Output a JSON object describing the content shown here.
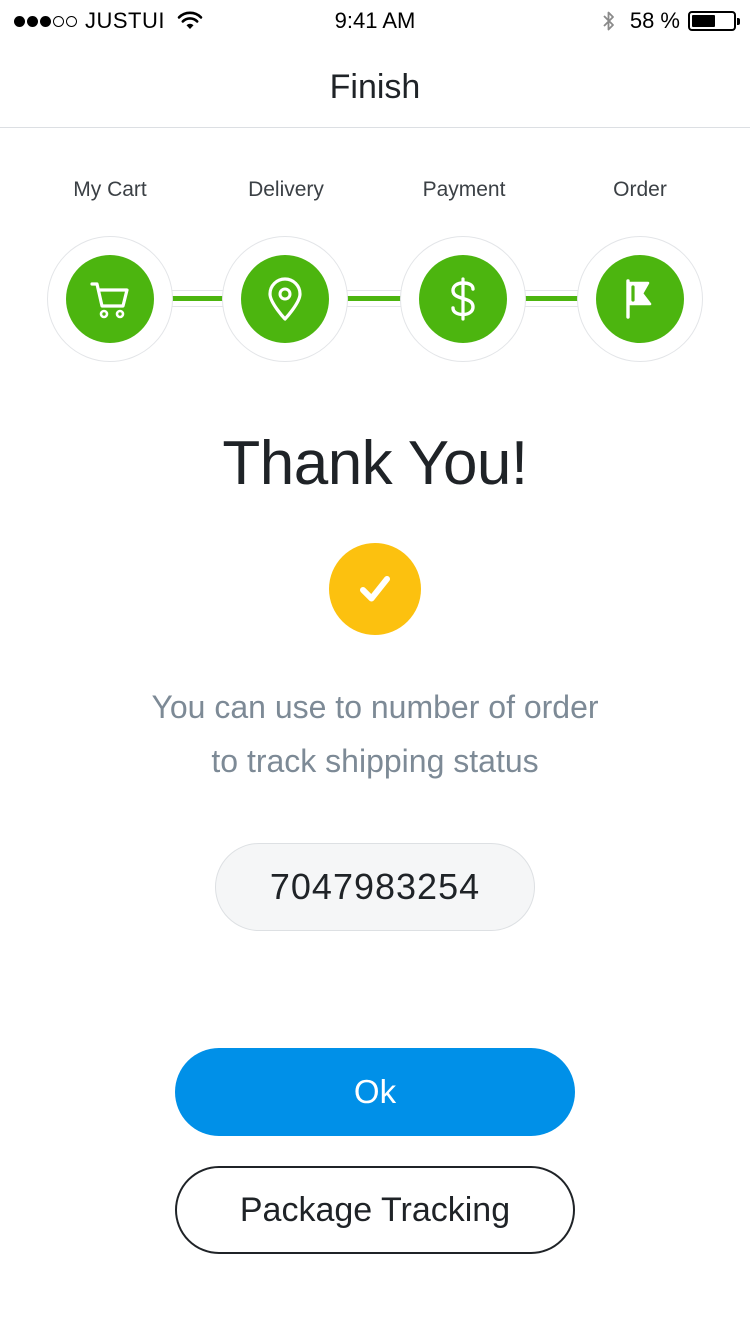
{
  "status_bar": {
    "carrier": "JUSTUI",
    "time": "9:41 AM",
    "battery_percent": "58 %",
    "battery_level": 0.58,
    "signal_bars_filled": 3,
    "signal_bars_total": 5,
    "icons": [
      "signal-dots-icon",
      "wifi-icon",
      "bluetooth-icon",
      "battery-icon"
    ]
  },
  "nav": {
    "title": "Finish"
  },
  "steps": [
    {
      "label": "My Cart",
      "icon": "cart-icon"
    },
    {
      "label": "Delivery",
      "icon": "location-pin-icon"
    },
    {
      "label": "Payment",
      "icon": "dollar-icon"
    },
    {
      "label": "Order",
      "icon": "flag-icon"
    }
  ],
  "main": {
    "title": "Thank You!",
    "message_line1": "You can use to number of order",
    "message_line2": "to track shipping status",
    "order_number": "7047983254"
  },
  "buttons": {
    "ok_label": "Ok",
    "tracking_label": "Package Tracking"
  },
  "colors": {
    "step_green": "#4cb50f",
    "check_yellow": "#fcc10f",
    "primary_blue": "#0090e8",
    "message_gray": "#7d8a96"
  }
}
